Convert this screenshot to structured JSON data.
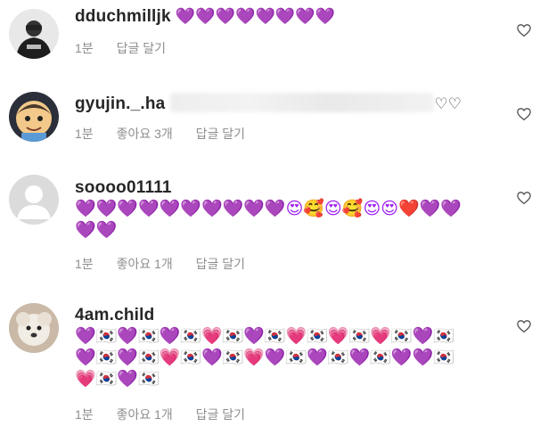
{
  "comments": [
    {
      "username": "dduchmilljk",
      "text_inline": "💜💜💜💜💜💜💜💜",
      "time": "1분",
      "likes": "",
      "reply": "답글 달기",
      "avatar": "person-dark-avatar"
    },
    {
      "username": "gyujin._.ha",
      "text_inline": "♡♡",
      "time": "1분",
      "likes": "좋아요 3개",
      "reply": "답글 달기",
      "avatar": "cartoon-avatar"
    },
    {
      "username": "soooo01111",
      "text_line1": "💜💜💜💜💜💜💜💜💜💜😍🥰😍🥰😍😍❤️💜💜",
      "text_line2": "💜💜",
      "time": "1분",
      "likes": "좋아요 1개",
      "reply": "답글 달기",
      "avatar": "default-avatar"
    },
    {
      "username": "4am.child",
      "text_line1": "💜🇰🇷💜🇰🇷💜🇰🇷💗🇰🇷💜🇰🇷💗🇰🇷💗🇰🇷💗🇰🇷💜🇰🇷",
      "text_line2": "💜🇰🇷💜🇰🇷💗🇰🇷💜🇰🇷💗💜🇰🇷💜🇰🇷💜🇰🇷💜💜🇰🇷",
      "text_line3": "💗🇰🇷💜🇰🇷",
      "time": "1분",
      "likes": "좋아요 1개",
      "reply": "답글 달기",
      "avatar": "puppy-avatar"
    }
  ],
  "icons": {
    "like": "heart-outline-icon"
  },
  "colors": {
    "purple_heart": "#a020f0",
    "pink_heart": "#ff3fa4",
    "red_heart": "#e0121b",
    "meta_text": "#8e8e8e"
  }
}
